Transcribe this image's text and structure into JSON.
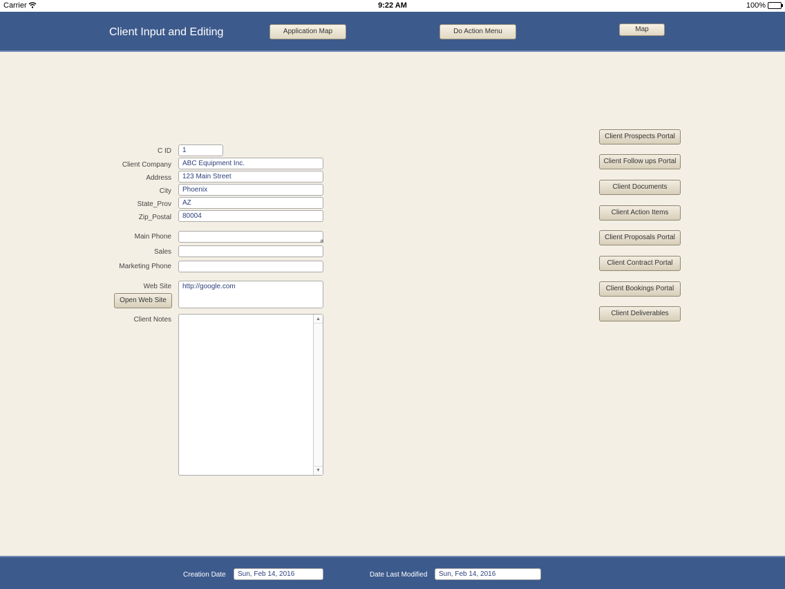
{
  "status_bar": {
    "carrier": "Carrier",
    "time": "9:22 AM",
    "battery": "100%",
    "battery_level": 1.0
  },
  "header": {
    "title": "Client Input and Editing",
    "buttons": {
      "application_map": "Application Map",
      "do_action_menu": "Do Action Menu",
      "map": "Map"
    }
  },
  "form": {
    "cid": {
      "label": "C ID",
      "value": "1"
    },
    "company": {
      "label": "Client Company",
      "value": "ABC Equipment Inc."
    },
    "address": {
      "label": "Address",
      "value": "123 Main Street"
    },
    "city": {
      "label": "City",
      "value": "Phoenix"
    },
    "state": {
      "label": "State_Prov",
      "value": "AZ"
    },
    "zip": {
      "label": "Zip_Postal",
      "value": "80004"
    },
    "main_phone": {
      "label": "Main Phone",
      "value": "",
      "marker": "a"
    },
    "sales": {
      "label": "Sales",
      "value": ""
    },
    "marketing_phone": {
      "label": "Marketing Phone",
      "value": ""
    },
    "web_site": {
      "label": "Web Site",
      "value": "http://google.com"
    },
    "open_web_site": "Open Web Site",
    "notes": {
      "label": "Client Notes",
      "value": ""
    }
  },
  "portals": [
    "Client Prospects Portal",
    "Client Follow ups Portal",
    "Client Documents",
    "Client Action Items",
    "Client Proposals Portal",
    "Client Contract Portal",
    "Client Bookings Portal",
    "Client Deliverables"
  ],
  "footer": {
    "creation_label": "Creation Date",
    "creation_value": "Sun, Feb 14, 2016",
    "modified_label": "Date Last Modified",
    "modified_value": "Sun, Feb 14, 2016"
  },
  "colors": {
    "band": "#3d5a8c",
    "background": "#f4efe4",
    "field_text": "#2d3f7a"
  }
}
